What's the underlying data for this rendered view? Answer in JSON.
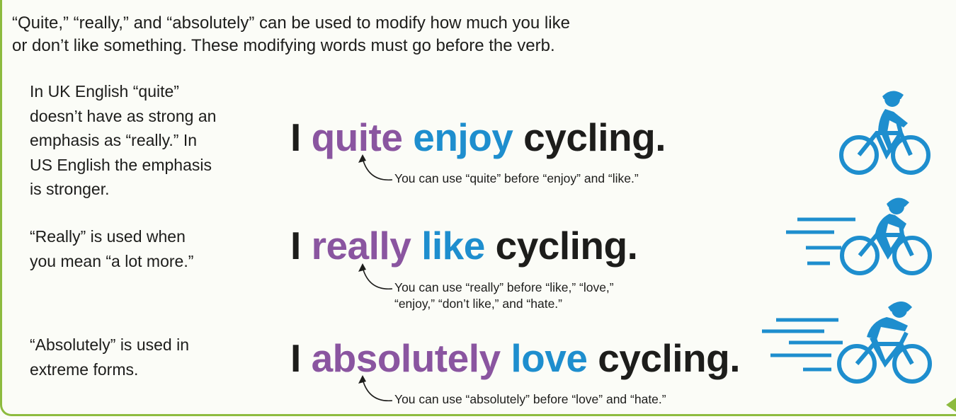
{
  "intro": {
    "line1": "“Quite,” “really,” and “absolutely” can be used to modify how much you like",
    "line2": "or don’t like something. These modifying words must go before the verb."
  },
  "notes": [
    "In UK English “quite” doesn’t have as strong an emphasis as “really.” In US English the emphasis is stronger.",
    "“Really” is used when you mean “a lot more.”",
    "“Absolutely” is used in extreme forms."
  ],
  "examples": [
    {
      "subject": "I",
      "modifier": "quite",
      "verb": "enjoy",
      "object": "cycling.",
      "hint_lines": [
        "You can use “quite” before “enjoy” and “like.”"
      ],
      "icon": "cyclist-slow-icon"
    },
    {
      "subject": "I",
      "modifier": "really",
      "verb": "like",
      "object": "cycling.",
      "hint_lines": [
        "You can use “really” before “like,” “love,”",
        "“enjoy,” “don’t like,” and “hate.”"
      ],
      "icon": "cyclist-medium-icon"
    },
    {
      "subject": "I",
      "modifier": "absolutely",
      "verb": "love",
      "object": "cycling.",
      "hint_lines": [
        "You can use “absolutely” before “love” and “hate.”"
      ],
      "icon": "cyclist-fast-icon"
    }
  ],
  "colors": {
    "modifier": "#8a55a0",
    "verb": "#1e8ece",
    "text": "#1d1d1b",
    "frame": "#8dbb3f",
    "icon": "#1e8ece"
  }
}
